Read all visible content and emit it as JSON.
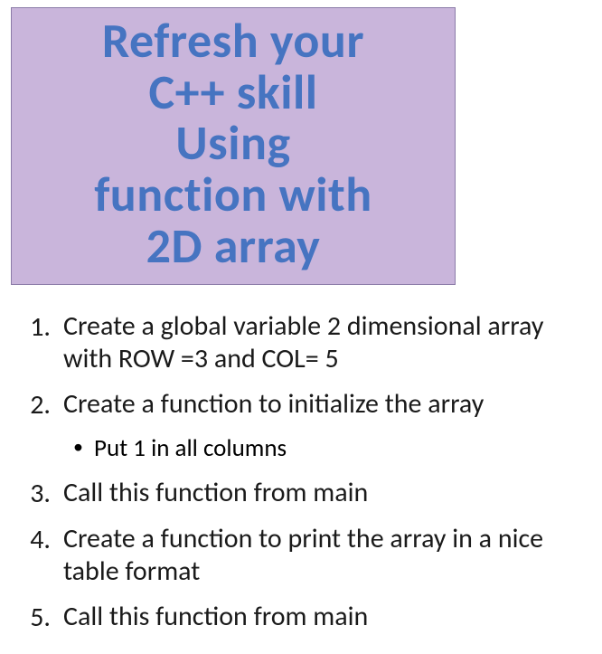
{
  "title": {
    "line1": "Refresh your",
    "line2": "C++ skill",
    "line3": "Using",
    "line4": "function with",
    "line5": "2D array"
  },
  "items": [
    {
      "number": "1.",
      "text": "Create a global variable 2 dimensional array with ROW =3  and COL= 5"
    },
    {
      "number": "2.",
      "text": "Create a function to initialize the array",
      "sub": {
        "bullet": "•",
        "text": "Put 1 in all columns"
      }
    },
    {
      "number": "3.",
      "text": "Call this function from main"
    },
    {
      "number": "4.",
      "text": "Create a function to print the array in a nice table format"
    },
    {
      "number": "5.",
      "text": "Call this function from main"
    }
  ]
}
